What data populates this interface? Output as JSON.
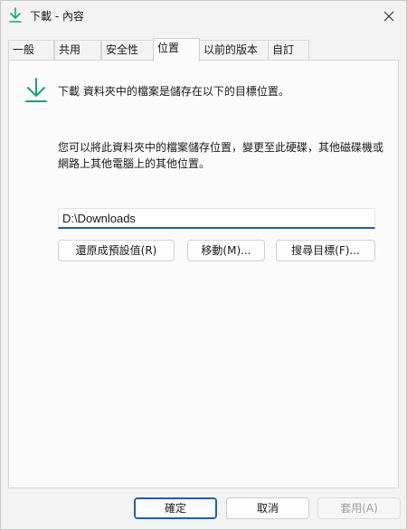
{
  "window": {
    "title": "下載 - 內容"
  },
  "tabs": [
    {
      "label": "一般"
    },
    {
      "label": "共用"
    },
    {
      "label": "安全性"
    },
    {
      "label": "位置"
    },
    {
      "label": "以前的版本"
    },
    {
      "label": "自訂"
    }
  ],
  "location": {
    "header": "下載 資料夾中的檔案是儲存在以下的目標位置。",
    "description": "您可以將此資料夾中的檔案儲存位置，變更至此硬碟，其他磁碟機或網路上其他電腦上的其他位置。",
    "path_value": "D:\\Downloads",
    "restore_button": "還原成預設值(R)",
    "move_button": "移動(M)...",
    "find_target_button": "搜尋目標(F)..."
  },
  "footer": {
    "ok_button": "確定",
    "cancel_button": "取消",
    "apply_button": "套用(A)"
  },
  "colors": {
    "accent": "#1f5fa8",
    "icon_green": "#1aa37a"
  }
}
